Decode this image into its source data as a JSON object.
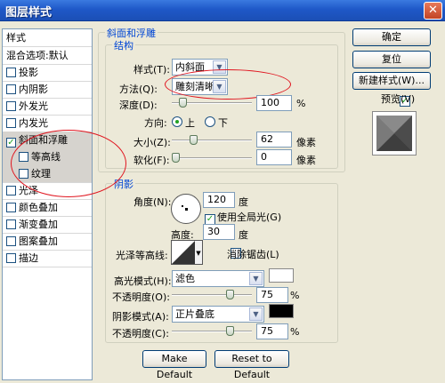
{
  "window": {
    "title": "图层样式",
    "close_glyph": "✕"
  },
  "left_list": {
    "header": "样式",
    "items": [
      {
        "label": "混合选项:默认",
        "checkbox": false,
        "checked": false,
        "selected": false,
        "sub": false
      },
      {
        "label": "投影",
        "checkbox": true,
        "checked": false,
        "selected": false,
        "sub": false
      },
      {
        "label": "内阴影",
        "checkbox": true,
        "checked": false,
        "selected": false,
        "sub": false
      },
      {
        "label": "外发光",
        "checkbox": true,
        "checked": false,
        "selected": false,
        "sub": false
      },
      {
        "label": "内发光",
        "checkbox": true,
        "checked": false,
        "selected": false,
        "sub": false
      },
      {
        "label": "斜面和浮雕",
        "checkbox": true,
        "checked": true,
        "selected": true,
        "sub": false
      },
      {
        "label": "等高线",
        "checkbox": true,
        "checked": false,
        "selected": true,
        "sub": true
      },
      {
        "label": "纹理",
        "checkbox": true,
        "checked": false,
        "selected": true,
        "sub": true
      },
      {
        "label": "光泽",
        "checkbox": true,
        "checked": false,
        "selected": false,
        "sub": false
      },
      {
        "label": "颜色叠加",
        "checkbox": true,
        "checked": false,
        "selected": false,
        "sub": false
      },
      {
        "label": "渐变叠加",
        "checkbox": true,
        "checked": false,
        "selected": false,
        "sub": false
      },
      {
        "label": "图案叠加",
        "checkbox": true,
        "checked": false,
        "selected": false,
        "sub": false
      },
      {
        "label": "描边",
        "checkbox": true,
        "checked": false,
        "selected": false,
        "sub": false
      }
    ]
  },
  "bevel": {
    "group_title": "斜面和浮雕",
    "structure_title": "结构",
    "style_label": "样式(T):",
    "style_value": "内斜面",
    "technique_label": "方法(Q):",
    "technique_value": "雕刻清晰",
    "depth_label": "深度(D):",
    "depth_value": "100",
    "depth_level": 0.1,
    "depth_unit": "%",
    "direction_label": "方向:",
    "dir_up": "上",
    "dir_down": "下",
    "size_label": "大小(Z):",
    "size_value": "62",
    "size_level": 0.25,
    "size_unit": "像素",
    "soften_label": "软化(F):",
    "soften_value": "0",
    "soften_level": 0.0,
    "soften_unit": "像素"
  },
  "shading": {
    "title": "阴影",
    "angle_label": "角度(N):",
    "angle_value": "120",
    "angle_unit": "度",
    "global_light_label": "使用全局光(G)",
    "altitude_label": "高度:",
    "altitude_value": "30",
    "altitude_unit": "度",
    "gloss_label": "光泽等高线:",
    "antialias_label": "消除锯齿(L)",
    "highlight_mode_label": "高光模式(H):",
    "highlight_mode_value": "滤色",
    "highlight_color": "#ffffff",
    "highlight_opacity_label": "不透明度(O):",
    "highlight_opacity_value": "75",
    "highlight_opacity_level": 0.75,
    "shadow_mode_label": "阴影模式(A):",
    "shadow_mode_value": "正片叠底",
    "shadow_color": "#000000",
    "shadow_opacity_label": "不透明度(C):",
    "shadow_opacity_value": "75",
    "shadow_opacity_level": 0.75,
    "pct": "%"
  },
  "bottom_buttons": {
    "make_default": "Make Default",
    "reset_default": "Reset to Default"
  },
  "right_buttons": {
    "ok": "确定",
    "reset": "复位",
    "new_style": "新建样式(W)...",
    "preview_label": "预览(V)"
  },
  "icons": {
    "dropdown": "▼",
    "check": "✓"
  }
}
